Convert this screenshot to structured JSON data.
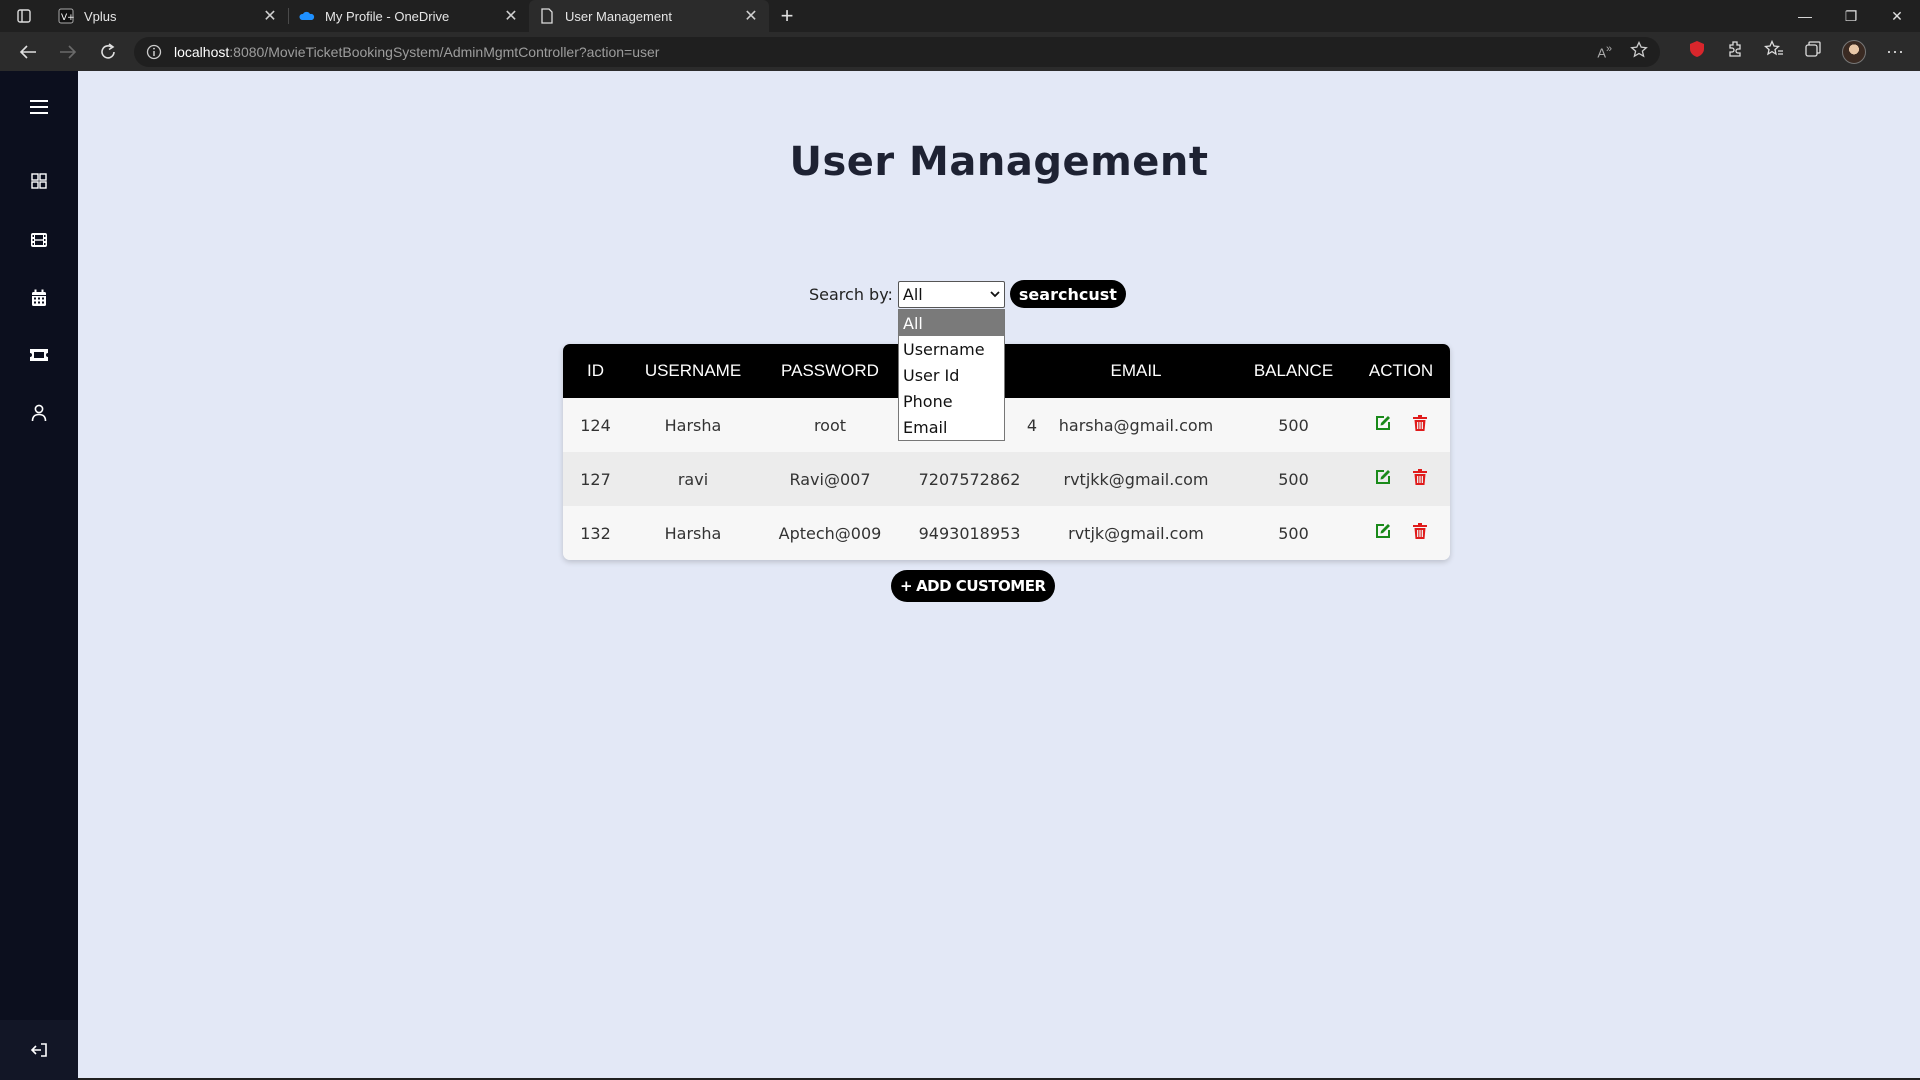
{
  "browser": {
    "tabs": [
      {
        "title": "Vplus",
        "favicon": "vplus-icon"
      },
      {
        "title": "My Profile - OneDrive",
        "favicon": "onedrive-icon"
      },
      {
        "title": "User Management",
        "favicon": "page-icon",
        "active": true
      }
    ],
    "address": {
      "host": "localhost",
      "path": ":8080/MovieTicketBookingSystem/AdminMgmtController?action=user"
    }
  },
  "sidebar": {
    "items": [
      {
        "icon": "menu-icon"
      },
      {
        "icon": "dashboard-icon"
      },
      {
        "icon": "film-icon"
      },
      {
        "icon": "calendar-icon"
      },
      {
        "icon": "ticket-icon"
      },
      {
        "icon": "user-icon"
      }
    ],
    "logout_icon": "logout-icon"
  },
  "page": {
    "title": "User Management"
  },
  "search": {
    "label": "Search by:",
    "selected": "All",
    "options": [
      "All",
      "Username",
      "User Id",
      "Phone",
      "Email"
    ],
    "button_label": "searchcust"
  },
  "table": {
    "headers": [
      "ID",
      "USERNAME",
      "PASSWORD",
      "",
      "EMAIL",
      "BALANCE",
      "ACTION"
    ],
    "rows": [
      {
        "id": "124",
        "username": "Harsha",
        "password": "root",
        "phone": "4",
        "email": "harsha@gmail.com",
        "balance": "500"
      },
      {
        "id": "127",
        "username": "ravi",
        "password": "Ravi@007",
        "phone": "7207572862",
        "email": "rvtjkk@gmail.com",
        "balance": "500"
      },
      {
        "id": "132",
        "username": "Harsha",
        "password": "Aptech@009",
        "phone": "9493018953",
        "email": "rvtjk@gmail.com",
        "balance": "500"
      }
    ]
  },
  "add_button": {
    "label": "ADD CUSTOMER"
  },
  "colors": {
    "sidebar": "#0c0f1e",
    "background": "#e3e8f6",
    "edit": "#1a8a1a",
    "delete": "#e01b1b"
  }
}
